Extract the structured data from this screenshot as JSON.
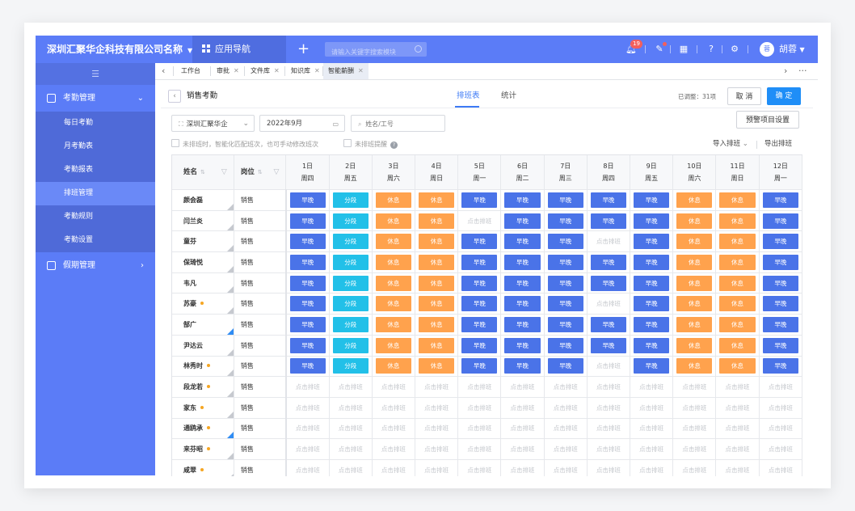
{
  "topbar": {
    "company": "深圳汇聚华企科技有限公司名称",
    "app_nav": "应用导航",
    "search_placeholder": "请输入关键字搜索模块",
    "notify_count": "19",
    "user": "胡蓉",
    "avatar_text": "蓉"
  },
  "sidebar": {
    "groups": [
      {
        "label": "考勤管理",
        "items": [
          "每日考勤",
          "月考勤表",
          "考勤报表",
          "排班管理",
          "考勤规则",
          "考勤设置"
        ],
        "active": "排班管理"
      },
      {
        "label": "假期管理"
      }
    ]
  },
  "tabs": [
    "工作台",
    "审批",
    "文件库",
    "知识库",
    "智能薪酬"
  ],
  "header": {
    "title": "销售考勤",
    "view_tabs": [
      "排班表",
      "统计"
    ],
    "adjusted": "已调整：31项",
    "cancel": "取 消",
    "confirm": "确 定"
  },
  "filters": {
    "company": "深圳汇聚华企",
    "month": "2022年9月",
    "search_placeholder": "姓名/工号",
    "warning_settings": "预警项目设置",
    "check1": "未排班时，智能化匹配班次，也可手动修改班次",
    "check2": "未排班提醒",
    "import": "导入排班",
    "export": "导出排班"
  },
  "table": {
    "col_name": "姓名",
    "col_position": "岗位",
    "days": [
      {
        "d": "1日",
        "w": "周四"
      },
      {
        "d": "2日",
        "w": "周五"
      },
      {
        "d": "3日",
        "w": "周六"
      },
      {
        "d": "4日",
        "w": "周日"
      },
      {
        "d": "5日",
        "w": "周一"
      },
      {
        "d": "6日",
        "w": "周二"
      },
      {
        "d": "7日",
        "w": "周三"
      },
      {
        "d": "8日",
        "w": "周四"
      },
      {
        "d": "9日",
        "w": "周五"
      },
      {
        "d": "10日",
        "w": "周六"
      },
      {
        "d": "11日",
        "w": "周日"
      },
      {
        "d": "12日",
        "w": "周一"
      }
    ],
    "rows": [
      {
        "name": "颜会磊",
        "pos": "销售",
        "dot": false,
        "tri": "grey",
        "cells": [
          "早晚",
          "分段",
          "休息",
          "休息",
          "早晚",
          "早晚",
          "早晚",
          "早晚",
          "早晚",
          "休息",
          "休息",
          "早晚"
        ]
      },
      {
        "name": "闫兰炎",
        "pos": "销售",
        "dot": false,
        "tri": "grey",
        "cells": [
          "早晚",
          "分段",
          "休息",
          "休息",
          "点击排班",
          "早晚",
          "早晚",
          "早晚",
          "早晚",
          "休息",
          "休息",
          "早晚"
        ]
      },
      {
        "name": "童芬",
        "pos": "销售",
        "dot": false,
        "tri": "grey",
        "cells": [
          "早晚",
          "分段",
          "休息",
          "休息",
          "早晚",
          "早晚",
          "早晚",
          "点击排班",
          "早晚",
          "休息",
          "休息",
          "早晚"
        ]
      },
      {
        "name": "保琦悦",
        "pos": "销售",
        "dot": false,
        "tri": "grey",
        "cells": [
          "早晚",
          "分段",
          "休息",
          "休息",
          "早晚",
          "早晚",
          "早晚",
          "早晚",
          "早晚",
          "休息",
          "休息",
          "早晚"
        ]
      },
      {
        "name": "韦凡",
        "pos": "销售",
        "dot": false,
        "tri": "grey",
        "cells": [
          "早晚",
          "分段",
          "休息",
          "休息",
          "早晚",
          "早晚",
          "早晚",
          "早晚",
          "早晚",
          "休息",
          "休息",
          "早晚"
        ]
      },
      {
        "name": "苏豪",
        "pos": "销售",
        "dot": true,
        "tri": "grey",
        "cells": [
          "早晚",
          "分段",
          "休息",
          "休息",
          "早晚",
          "早晚",
          "早晚",
          "点击排班",
          "早晚",
          "休息",
          "休息",
          "早晚"
        ]
      },
      {
        "name": "郜广",
        "pos": "销售",
        "dot": false,
        "tri": "blue",
        "cells": [
          "早晚",
          "分段",
          "休息",
          "休息",
          "早晚",
          "早晚",
          "早晚",
          "早晚",
          "早晚",
          "休息",
          "休息",
          "早晚"
        ]
      },
      {
        "name": "尹达云",
        "pos": "销售",
        "dot": false,
        "tri": "grey",
        "cells": [
          "早晚",
          "分段",
          "休息",
          "休息",
          "早晚",
          "早晚",
          "早晚",
          "早晚",
          "早晚",
          "休息",
          "休息",
          "早晚"
        ]
      },
      {
        "name": "林秀时",
        "pos": "销售",
        "dot": true,
        "tri": "grey",
        "cells": [
          "早晚",
          "分段",
          "休息",
          "休息",
          "早晚",
          "早晚",
          "早晚",
          "点击排班",
          "早晚",
          "休息",
          "休息",
          "早晚"
        ]
      },
      {
        "name": "段龙若",
        "pos": "销售",
        "dot": true,
        "tri": "grey",
        "cells": [
          "点击排班",
          "点击排班",
          "点击排班",
          "点击排班",
          "点击排班",
          "点击排班",
          "点击排班",
          "点击排班",
          "点击排班",
          "点击排班",
          "点击排班",
          "点击排班"
        ]
      },
      {
        "name": "家东",
        "pos": "销售",
        "dot": true,
        "tri": "grey",
        "cells": [
          "点击排班",
          "点击排班",
          "点击排班",
          "点击排班",
          "点击排班",
          "点击排班",
          "点击排班",
          "点击排班",
          "点击排班",
          "点击排班",
          "点击排班",
          "点击排班"
        ]
      },
      {
        "name": "通鸥承",
        "pos": "销售",
        "dot": true,
        "tri": "blue",
        "cells": [
          "点击排班",
          "点击排班",
          "点击排班",
          "点击排班",
          "点击排班",
          "点击排班",
          "点击排班",
          "点击排班",
          "点击排班",
          "点击排班",
          "点击排班",
          "点击排班"
        ]
      },
      {
        "name": "来芬昭",
        "pos": "销售",
        "dot": true,
        "tri": "grey",
        "cells": [
          "点击排班",
          "点击排班",
          "点击排班",
          "点击排班",
          "点击排班",
          "点击排班",
          "点击排班",
          "点击排班",
          "点击排班",
          "点击排班",
          "点击排班",
          "点击排班"
        ]
      },
      {
        "name": "咸翠",
        "pos": "销售",
        "dot": true,
        "tri": "grey",
        "cells": [
          "点击排班",
          "点击排班",
          "点击排班",
          "点击排班",
          "点击排班",
          "点击排班",
          "点击排班",
          "点击排班",
          "点击排班",
          "点击排班",
          "点击排班",
          "点击排班"
        ]
      }
    ]
  },
  "colors": {
    "primary": "#5b7cf7",
    "shift_early_late": "#4a73e8",
    "shift_split": "#22c0e8",
    "shift_rest": "#ffa24d"
  }
}
